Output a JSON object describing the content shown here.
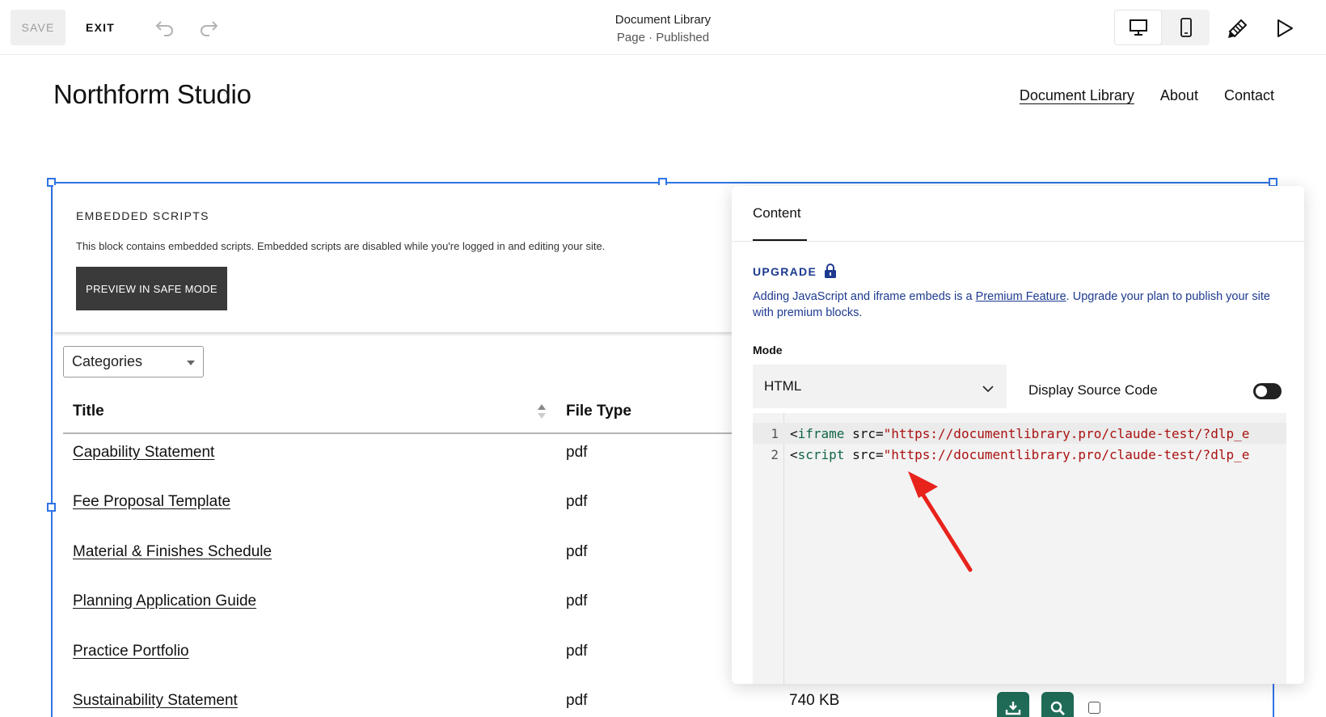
{
  "toolbar": {
    "save_label": "SAVE",
    "exit_label": "EXIT",
    "page_name": "Document Library",
    "page_status": "Page · Published",
    "icons": [
      "undo-icon",
      "redo-icon",
      "desktop-icon",
      "mobile-icon",
      "design-brush-icon",
      "preview-play-icon"
    ]
  },
  "site": {
    "title": "Northform Studio",
    "nav": [
      {
        "label": "Document Library",
        "current": true
      },
      {
        "label": "About",
        "current": false
      },
      {
        "label": "Contact",
        "current": false
      }
    ]
  },
  "embed_notice": {
    "heading": "EMBEDDED SCRIPTS",
    "text": "This block contains embedded scripts. Embedded scripts are disabled while you're logged in and editing your site.",
    "button": "PREVIEW IN SAFE MODE"
  },
  "library": {
    "filter_value": "Categories",
    "columns": [
      "Title",
      "File Type"
    ],
    "rows": [
      {
        "title": "Capability Statement",
        "type": "pdf"
      },
      {
        "title": "Fee Proposal Template",
        "type": "pdf"
      },
      {
        "title": "Material & Finishes Schedule",
        "type": "pdf"
      },
      {
        "title": "Planning Application Guide",
        "type": "pdf"
      },
      {
        "title": "Practice Portfolio",
        "type": "pdf"
      },
      {
        "title": "Sustainability Statement",
        "type": "pdf",
        "size": "740 KB"
      }
    ]
  },
  "panel": {
    "tab": "Content",
    "upgrade_heading": "UPGRADE",
    "upgrade_pre": "Adding JavaScript and iframe embeds is a ",
    "upgrade_link": "Premium Feature",
    "upgrade_post": ". Upgrade your plan to publish your site with premium blocks.",
    "mode_label": "Mode",
    "mode_value": "HTML",
    "source_label": "Display Source Code",
    "source_on": false,
    "code": [
      {
        "num": "1",
        "open": "<",
        "tag": "iframe",
        "attr": " src=",
        "value": "\"https://documentlibrary.pro/claude-test/?dlp_e"
      },
      {
        "num": "2",
        "open": "<",
        "tag": "script",
        "attr": " src=",
        "value": "\"https://documentlibrary.pro/claude-test/?dlp_e"
      }
    ]
  },
  "colors": {
    "accent_blue": "#2f74e5",
    "upgrade_navy": "#1d3a8f",
    "action_green": "#1f6b58",
    "annotation_red": "#e8231c"
  }
}
